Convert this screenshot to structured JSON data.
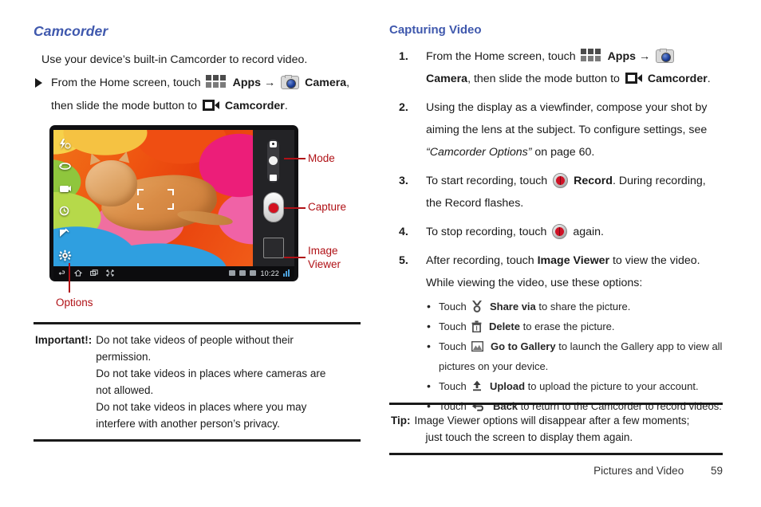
{
  "left_column": {
    "heading": "Camcorder",
    "intro": "Use your device’s built-in Camcorder to record video.",
    "bullet": {
      "text_1": "From the Home screen, touch",
      "apps_label": "Apps",
      "arrow": "→",
      "camera_label": "Camera",
      "comma": ",",
      "text_2": "then slide the mode button to",
      "camcorder_label": "Camcorder",
      "period": "."
    },
    "figure": {
      "callouts": {
        "mode": "Mode",
        "capture": "Capture",
        "image_viewer": "Image\nViewer",
        "options": "Options"
      },
      "status_bar": {
        "time": "10:22"
      },
      "option_icons": [
        "flash-off-icon",
        "switch-camera-icon",
        "shooting-mode-icon",
        "timer-off-icon",
        "exposure-icon",
        "settings-gear-icon"
      ],
      "controls": {
        "mode_switch": "mode-switch-toggle",
        "capture": "capture-record-button",
        "viewer": "image-viewer-thumbnail"
      }
    },
    "important_note": {
      "label": "Important!:",
      "lines": [
        "Do not take videos of people without their",
        "permission.",
        "Do not take videos in places where cameras are",
        "not allowed.",
        "Do not take videos in places where you may",
        "interfere with another person’s privacy."
      ]
    }
  },
  "right_column": {
    "heading": "Capturing Video",
    "steps": [
      {
        "num": "1.",
        "segments": [
          {
            "type": "text",
            "value": "From the Home screen, touch "
          },
          {
            "type": "icon",
            "value": "apps-grid-icon"
          },
          {
            "type": "bold",
            "value": "Apps"
          },
          {
            "type": "text",
            "value": " → "
          },
          {
            "type": "icon",
            "value": "camera-icon"
          },
          {
            "type": "bold",
            "value": "Camera"
          },
          {
            "type": "text",
            "value": ", then slide the mode button to "
          },
          {
            "type": "icon",
            "value": "camcorder-icon"
          },
          {
            "type": "bold",
            "value": "Camcorder"
          },
          {
            "type": "text",
            "value": "."
          }
        ]
      },
      {
        "num": "2.",
        "segments": [
          {
            "type": "text",
            "value": "Using the display as a viewfinder, compose your shot by aiming the lens at the subject. To configure settings, see "
          },
          {
            "type": "italic",
            "value": "“Camcorder Options”"
          },
          {
            "type": "text",
            "value": " on page 60."
          }
        ]
      },
      {
        "num": "3.",
        "segments": [
          {
            "type": "text",
            "value": "To start recording, touch "
          },
          {
            "type": "icon",
            "value": "record-icon"
          },
          {
            "type": "bold",
            "value": "Record"
          },
          {
            "type": "text",
            "value": ". During recording, the Record flashes."
          }
        ]
      },
      {
        "num": "4.",
        "segments": [
          {
            "type": "text",
            "value": "To stop recording, touch "
          },
          {
            "type": "icon",
            "value": "record-icon"
          },
          {
            "type": "text",
            "value": " again."
          }
        ]
      },
      {
        "num": "5.",
        "segments": [
          {
            "type": "text",
            "value": "After recording, touch "
          },
          {
            "type": "bold",
            "value": "Image Viewer"
          },
          {
            "type": "text",
            "value": " to view the video. While viewing the video, use these options:"
          }
        ]
      }
    ],
    "step5_bullets": [
      {
        "lead": "Touch",
        "icon": "share-via-icon",
        "label": "Share via",
        "tail": "to share the picture."
      },
      {
        "lead": "Touch",
        "icon": "delete-trash-icon",
        "label": "Delete",
        "tail": "to erase the picture."
      },
      {
        "lead": "Touch",
        "icon": "gallery-icon",
        "label": "Go to Gallery",
        "tail": "to launch the Gallery app to view all pictures on your device."
      },
      {
        "lead": "Touch",
        "icon": "upload-icon",
        "label": "Upload",
        "tail": "to upload the picture to your account."
      },
      {
        "lead": "Touch",
        "icon": "back-arrow-icon",
        "label": "Back",
        "tail": "to return to the Camcorder to record videos."
      }
    ],
    "tip_note": {
      "label": "Tip:",
      "lines": [
        "Image Viewer options will disappear after a few moments;",
        "just touch the screen to display them again."
      ]
    }
  },
  "footer": {
    "section": "Pictures and Video",
    "page_number": "59"
  },
  "colors": {
    "heading_blue": "#3f58ad",
    "callout_red": "#b01116",
    "record_red": "#cf1125",
    "text_black": "#1a1a1a"
  }
}
